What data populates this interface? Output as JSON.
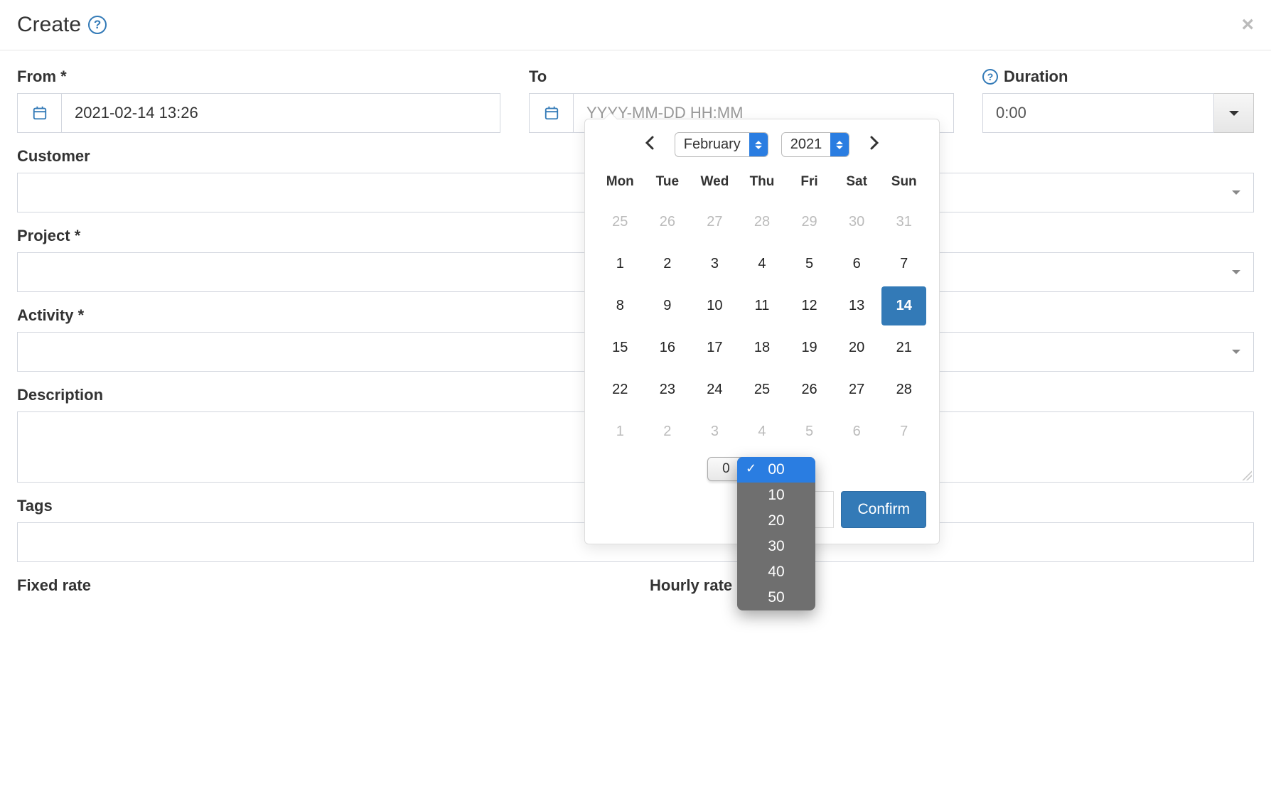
{
  "header": {
    "title": "Create"
  },
  "fields": {
    "from": {
      "label": "From *",
      "value": "2021-02-14 13:26"
    },
    "to": {
      "label": "To",
      "placeholder": "YYYY-MM-DD HH:MM"
    },
    "duration": {
      "label": "Duration",
      "value": "0:00"
    },
    "customer": {
      "label": "Customer"
    },
    "project": {
      "label": "Project *"
    },
    "activity": {
      "label": "Activity *"
    },
    "description": {
      "label": "Description"
    },
    "tags": {
      "label": "Tags"
    },
    "fixed_rate": {
      "label": "Fixed rate"
    },
    "hourly_rate": {
      "label": "Hourly rate"
    }
  },
  "datepicker": {
    "month": "February",
    "year": "2021",
    "dow": [
      "Mon",
      "Tue",
      "Wed",
      "Thu",
      "Fri",
      "Sat",
      "Sun"
    ],
    "weeks": [
      [
        {
          "d": "25",
          "o": true
        },
        {
          "d": "26",
          "o": true
        },
        {
          "d": "27",
          "o": true
        },
        {
          "d": "28",
          "o": true
        },
        {
          "d": "29",
          "o": true
        },
        {
          "d": "30",
          "o": true
        },
        {
          "d": "31",
          "o": true
        }
      ],
      [
        {
          "d": "1"
        },
        {
          "d": "2"
        },
        {
          "d": "3"
        },
        {
          "d": "4"
        },
        {
          "d": "5"
        },
        {
          "d": "6"
        },
        {
          "d": "7"
        }
      ],
      [
        {
          "d": "8"
        },
        {
          "d": "9"
        },
        {
          "d": "10"
        },
        {
          "d": "11"
        },
        {
          "d": "12"
        },
        {
          "d": "13"
        },
        {
          "d": "14",
          "sel": true
        }
      ],
      [
        {
          "d": "15"
        },
        {
          "d": "16"
        },
        {
          "d": "17"
        },
        {
          "d": "18"
        },
        {
          "d": "19"
        },
        {
          "d": "20"
        },
        {
          "d": "21"
        }
      ],
      [
        {
          "d": "22"
        },
        {
          "d": "23"
        },
        {
          "d": "24"
        },
        {
          "d": "25"
        },
        {
          "d": "26"
        },
        {
          "d": "27"
        },
        {
          "d": "28"
        }
      ],
      [
        {
          "d": "1",
          "o": true
        },
        {
          "d": "2",
          "o": true
        },
        {
          "d": "3",
          "o": true
        },
        {
          "d": "4",
          "o": true
        },
        {
          "d": "5",
          "o": true
        },
        {
          "d": "6",
          "o": true
        },
        {
          "d": "7",
          "o": true
        }
      ]
    ],
    "hour": "0",
    "minute_options": [
      "00",
      "10",
      "20",
      "30",
      "40",
      "50"
    ],
    "minute_selected": "00",
    "confirm": "Confirm"
  }
}
